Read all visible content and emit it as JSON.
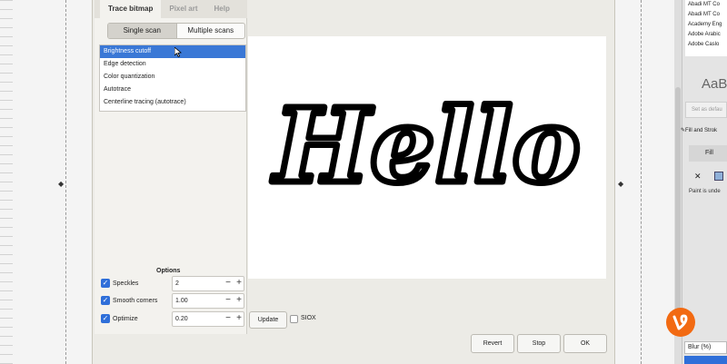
{
  "tabs": [
    {
      "label": "Trace bitmap",
      "active": true
    },
    {
      "label": "Pixel art",
      "active": false
    },
    {
      "label": "Help",
      "active": false
    }
  ],
  "scan_modes": [
    {
      "label": "Single scan",
      "active": true
    },
    {
      "label": "Multiple scans",
      "active": false
    }
  ],
  "trace_modes": [
    {
      "label": "Brightness cutoff",
      "selected": true
    },
    {
      "label": "Edge detection",
      "selected": false
    },
    {
      "label": "Color quantization",
      "selected": false
    },
    {
      "label": "Autotrace",
      "selected": false
    },
    {
      "label": "Centerline tracing (autotrace)",
      "selected": false
    }
  ],
  "options": {
    "title": "Options",
    "rows": [
      {
        "label": "Speckles",
        "value": "2",
        "checked": true
      },
      {
        "label": "Smooth corners",
        "value": "1.00",
        "checked": true
      },
      {
        "label": "Optimize",
        "value": "0.20",
        "checked": true
      }
    ]
  },
  "preview": {
    "text": "Hello"
  },
  "actions": {
    "update": "Update",
    "siox": "SIOX"
  },
  "footer": {
    "revert": "Revert",
    "stop": "Stop",
    "ok": "OK"
  },
  "right_panel": {
    "fonts": [
      "Abadi MT Co",
      "Abadi MT Co",
      "Academy Eng",
      "Adobe Arabic",
      "Adobe Caslo"
    ],
    "font_preview": "AaB",
    "set_default": "Set as defau",
    "fill_stroke": "Fill and Strok",
    "fill_tab": "Fill",
    "paint_undefined": "Paint is unde",
    "blur": "Blur (%)"
  },
  "colors": {
    "accent": "#3a78d6",
    "checkbox": "#2f6fd9",
    "vine": "#f26a12"
  }
}
